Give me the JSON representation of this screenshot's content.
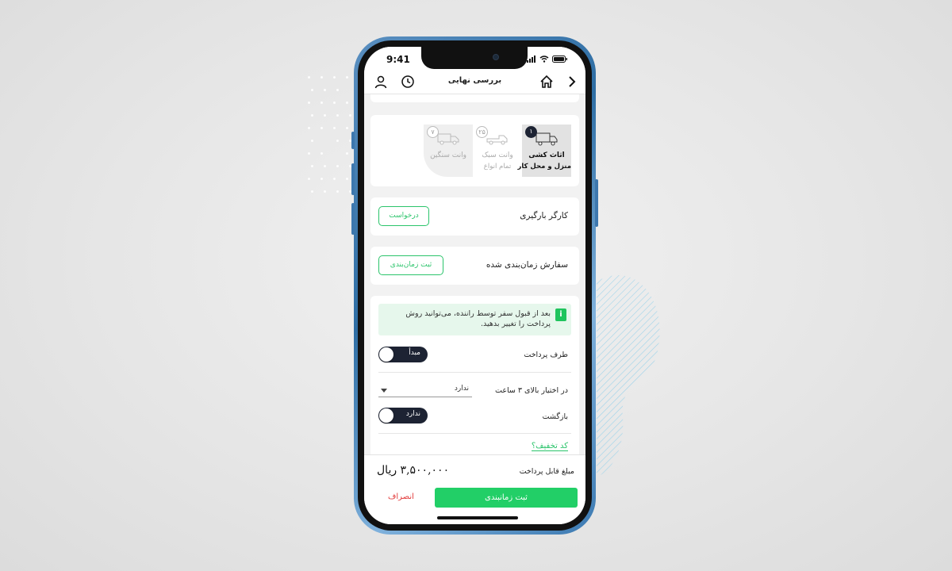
{
  "status_bar": {
    "time": "9:41"
  },
  "header": {
    "title": "بررسی نهایی",
    "icons": [
      "back-chevron-icon",
      "home-icon",
      "clock-icon",
      "user-icon"
    ]
  },
  "vehicle_types": [
    {
      "title": "اثاث کشی",
      "subtitle": "منزل و محل کار",
      "badge": "۱",
      "selected": true
    },
    {
      "title": "وانت سبک",
      "subtitle": "تمام انواع",
      "badge": "۲۵",
      "selected": false
    },
    {
      "title": "وانت سنگین",
      "subtitle": "",
      "badge": "۷",
      "selected": false
    }
  ],
  "loader_worker": {
    "label": "کارگر بارگیری",
    "button": "درخواست"
  },
  "scheduled_order": {
    "label": "سفارش زمان‌بندی شده",
    "button": "ثبت زمان‌بندی"
  },
  "payment": {
    "info": "بعد از قبول سفر توسط راننده، می‌توانید روش پرداخت را تغییر بدهید.",
    "side_label": "طرف پرداخت",
    "side_value": "مبدأ",
    "over3h_label": "در اختیار بالای ۳ ساعت",
    "over3h_value": "ندارد",
    "return_label": "بازگشت",
    "return_value": "ندارد",
    "discount_link": "کد تخفیف؟"
  },
  "footer": {
    "amount_label": "مبلغ قابل پرداخت",
    "amount_value": "۳,۵۰۰,۰۰۰ ریال",
    "submit_label": "ثبت زمانبندی",
    "cancel_label": "انصراف"
  },
  "colors": {
    "accent": "#22cf67",
    "dark": "#1d2333",
    "danger": "#e23b3b",
    "frame": "#2f6ea4"
  }
}
